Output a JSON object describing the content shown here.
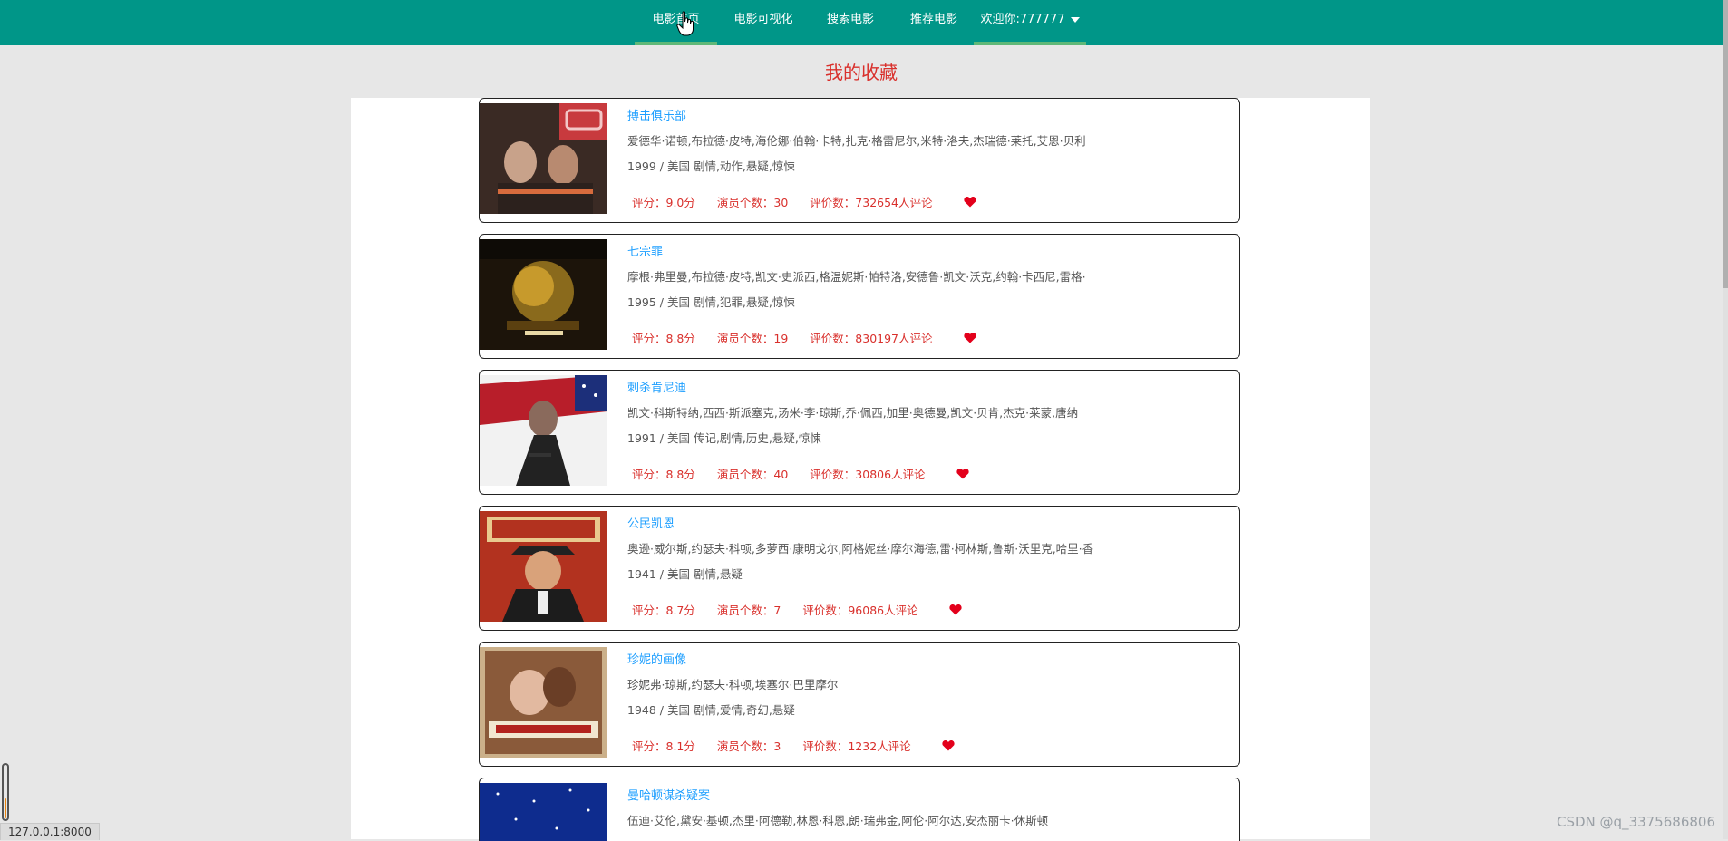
{
  "nav": {
    "items": [
      {
        "label": "电影首页"
      },
      {
        "label": "电影可视化"
      },
      {
        "label": "搜索电影"
      },
      {
        "label": "推荐电影"
      }
    ],
    "user_menu": "欢迎你:777777"
  },
  "page_title": "我的收藏",
  "movies": [
    {
      "title": "搏击俱乐部",
      "actors": "爱德华·诺顿,布拉德·皮特,海伦娜·伯翰·卡特,扎克·格雷尼尔,米特·洛夫,杰瑞德·莱托,艾恩·贝利",
      "meta": "1999 / 美国 剧情,动作,悬疑,惊悚",
      "rating": "评分：9.0分",
      "actor_count": "演员个数：30",
      "reviews": "评价数：732654人评论"
    },
    {
      "title": "七宗罪",
      "actors": "摩根·弗里曼,布拉德·皮特,凯文·史派西,格温妮斯·帕特洛,安德鲁·凯文·沃克,约翰·卡西尼,雷格·",
      "meta": "1995 / 美国 剧情,犯罪,悬疑,惊悚",
      "rating": "评分：8.8分",
      "actor_count": "演员个数：19",
      "reviews": "评价数：830197人评论"
    },
    {
      "title": "刺杀肯尼迪",
      "actors": "凯文·科斯特纳,西西·斯派塞克,汤米·李·琼斯,乔·佩西,加里·奥德曼,凯文·贝肯,杰克·莱蒙,唐纳",
      "meta": "1991 / 美国 传记,剧情,历史,悬疑,惊悚",
      "rating": "评分：8.8分",
      "actor_count": "演员个数：40",
      "reviews": "评价数：30806人评论"
    },
    {
      "title": "公民凯恩",
      "actors": "奥逊·威尔斯,约瑟夫·科顿,多萝西·康明戈尔,阿格妮丝·摩尔海德,雷·柯林斯,鲁斯·沃里克,哈里·香",
      "meta": "1941 / 美国 剧情,悬疑",
      "rating": "评分：8.7分",
      "actor_count": "演员个数：7",
      "reviews": "评价数：96086人评论"
    },
    {
      "title": "珍妮的画像",
      "actors": "珍妮弗·琼斯,约瑟夫·科顿,埃塞尔·巴里摩尔",
      "meta": "1948 / 美国 剧情,爱情,奇幻,悬疑",
      "rating": "评分：8.1分",
      "actor_count": "演员个数：3",
      "reviews": "评价数：1232人评论"
    },
    {
      "title": "曼哈顿谋杀疑案",
      "actors": "伍迪·艾伦,黛安·基顿,杰里·阿德勒,林恩·科恩,朗·瑞弗金,阿伦·阿尔达,安杰丽卡·休斯顿",
      "meta": "",
      "rating": "",
      "actor_count": "",
      "reviews": ""
    }
  ],
  "status_url": "127.0.0.1:8000",
  "watermark": "CSDN @q_3375686806",
  "colors": {
    "nav_bg": "#009688",
    "nav_active": "#5FB878",
    "accent_red": "#d9302c",
    "link_blue": "#1e9fff"
  },
  "icons": [
    "heart-icon",
    "chevron-down-icon",
    "hand-cursor-icon"
  ]
}
